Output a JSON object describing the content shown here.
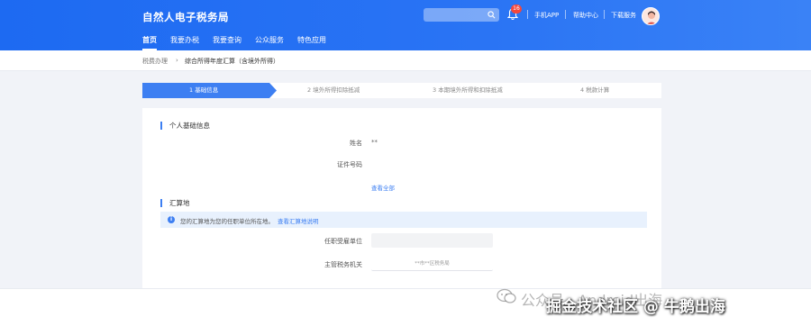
{
  "header": {
    "brand": "自然人电子税务局",
    "notification_count": "16",
    "links": [
      "手机APP",
      "帮助中心",
      "下载服务"
    ]
  },
  "nav": {
    "items": [
      "首页",
      "我要办税",
      "我要查询",
      "公众服务",
      "特色应用"
    ],
    "active_index": 0
  },
  "breadcrumb": [
    "税费办理",
    "综合所得年度汇算（含境外所得）"
  ],
  "steps": [
    "1  基础信息",
    "2  境外所得扣除抵减",
    "3  本期境外所得和扣除抵减",
    "4  税款计算"
  ],
  "sections": {
    "basic": {
      "title": "个人基础信息",
      "name_label": "姓名",
      "name_value": "**",
      "id_label": "证件号码",
      "id_value": "",
      "view_all": "查看全部"
    },
    "filing": {
      "title": "汇算地",
      "notice_text": "您的汇算地为您的任职单位所在地。",
      "notice_link": "查看汇算地说明",
      "employer_label": "任职受雇单位",
      "employer_value": "",
      "authority_label": "主管税务机关",
      "authority_value": "**市**区税务局"
    }
  },
  "watermark": {
    "left": "公众号 · Android出海",
    "right": "掘金技术社区 @ 牛鹅出海"
  },
  "colors": {
    "primary": "#2a74f4",
    "accent_link": "#3d7ff2",
    "badge": "#f5483d",
    "notice_bg": "#e8f1fd"
  }
}
